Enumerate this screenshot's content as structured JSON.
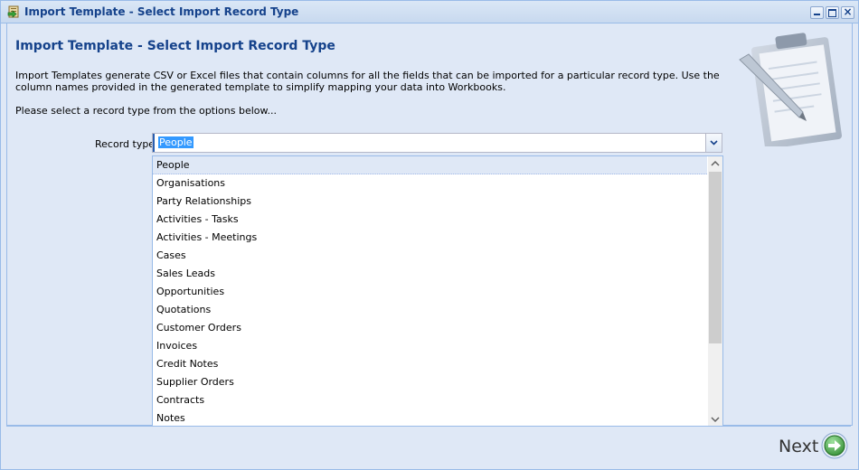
{
  "window": {
    "title": "Import Template - Select Import Record Type",
    "icons": {
      "app": "import-template-icon",
      "minimize": "minimize-icon",
      "maximize": "maximize-icon",
      "close": "close-icon"
    },
    "close_glyph": "×"
  },
  "page": {
    "heading": "Import Template - Select Import Record Type",
    "description": "Import Templates generate CSV or Excel files that contain columns for all the fields that can be imported for a particular record type. Use the column names provided in the generated template to simplify mapping your data into Workbooks.",
    "prompt": "Please select a record type from the options below..."
  },
  "record_type": {
    "label": "Record type",
    "value": "People",
    "trigger_icon": "chevron-down-icon",
    "options": [
      "People",
      "Organisations",
      "Party Relationships",
      "Activities - Tasks",
      "Activities - Meetings",
      "Cases",
      "Sales Leads",
      "Opportunities",
      "Quotations",
      "Customer Orders",
      "Invoices",
      "Credit Notes",
      "Supplier Orders",
      "Contracts",
      "Notes"
    ],
    "selected_index": 0
  },
  "footer": {
    "next_label": "Next",
    "next_icon": "arrow-right-circle-icon"
  },
  "colors": {
    "title": "#15428b",
    "panel": "#dfe8f6",
    "border": "#99bbe8",
    "selection": "#3399ff",
    "next_green": "#3a9a3a"
  }
}
